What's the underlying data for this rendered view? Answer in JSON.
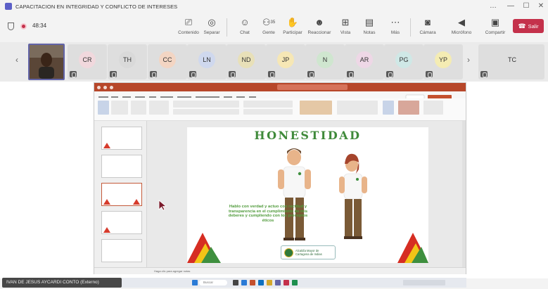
{
  "window": {
    "title": "CAPACITACION EN INTEGRIDAD Y CONFLICTO DE INTERESES",
    "controls": [
      "…",
      "—",
      "☐",
      "✕"
    ]
  },
  "meeting": {
    "timer": "48:34",
    "toolbar": [
      {
        "icon": "share-screen-icon",
        "glyph": "⎚",
        "label": "Contenido"
      },
      {
        "icon": "separate-icon",
        "glyph": "◎",
        "label": "Separar"
      },
      {
        "icon": "chat-icon",
        "glyph": "☺",
        "label": "Chat"
      },
      {
        "icon": "people-icon",
        "glyph": "⚇",
        "label": "Gente",
        "badge": "35"
      },
      {
        "icon": "raise-hand-icon",
        "glyph": "✋",
        "label": "Participar"
      },
      {
        "icon": "react-icon",
        "glyph": "☻",
        "label": "Reaccionar"
      },
      {
        "icon": "view-icon",
        "glyph": "⊞",
        "label": "Vista"
      },
      {
        "icon": "notes-icon",
        "glyph": "▤",
        "label": "Notas"
      },
      {
        "icon": "more-icon",
        "glyph": "⋯",
        "label": "Más"
      },
      {
        "icon": "camera-off-icon",
        "glyph": "◙",
        "label": "Cámara"
      },
      {
        "icon": "mic-off-icon",
        "glyph": "◀",
        "label": "Micrófono"
      },
      {
        "icon": "share-icon",
        "glyph": "▣",
        "label": "Compartir"
      }
    ],
    "leave_label": "Salir"
  },
  "participants": [
    {
      "initials": "CR",
      "color": "#f1d8dd"
    },
    {
      "initials": "TH",
      "color": "#d9d9d9"
    },
    {
      "initials": "CC",
      "color": "#f3d5c3"
    },
    {
      "initials": "LN",
      "color": "#cfd8ee"
    },
    {
      "initials": "ND",
      "color": "#e8e0b8"
    },
    {
      "initials": "JP",
      "color": "#f6e7b5"
    },
    {
      "initials": "N",
      "color": "#cfe6cf"
    },
    {
      "initials": "AR",
      "color": "#eed7e6"
    },
    {
      "initials": "PG",
      "color": "#cfe8e6"
    },
    {
      "initials": "YP",
      "color": "#f4ecb3"
    },
    {
      "initials": "TC",
      "color": "#dedede"
    }
  ],
  "presenter_name": "IVAN DE JESUS AYCARDI CONTO (Externo)",
  "slide": {
    "title": "HONESTIDAD",
    "body": "Hablo con verdad y actuo con rectitud y transparencia en el cumplimiento de mis deberes y cumpliendo con los preceptos éticos",
    "logo_text_1": "Alcaldía Mayor de",
    "logo_text_2": "Cartagena de Indias",
    "accent": "#3f8a3a"
  },
  "powerpoint": {
    "status": "Haga clic para agregar notas",
    "taskbar_search": "Buscar"
  }
}
